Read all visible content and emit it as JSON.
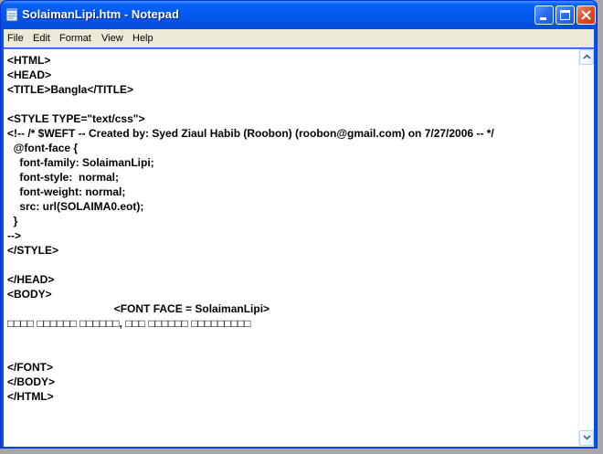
{
  "window": {
    "title": "SolaimanLipi.htm - Notepad",
    "icon": "notepad-icon",
    "controls": {
      "minimize": "minimize-icon",
      "maximize": "maximize-icon",
      "close": "close-icon"
    }
  },
  "menu": {
    "items": [
      "File",
      "Edit",
      "Format",
      "View",
      "Help"
    ]
  },
  "editor": {
    "lines": [
      "<HTML>",
      "<HEAD>",
      "<TITLE>Bangla</TITLE>",
      "",
      "<STYLE TYPE=\"text/css\">",
      "<!-- /* $WEFT -- Created by: Syed Ziaul Habib (Roobon) (roobon@gmail.com) on 7/27/2006 -- */",
      "  @font-face {",
      "    font-family: SolaimanLipi;",
      "    font-style:  normal;",
      "    font-weight: normal;",
      "    src: url(SOLAIMA0.eot);",
      "  }",
      "-->",
      "</STYLE>",
      "",
      "</HEAD>",
      "<BODY>",
      "                                   <FONT FACE = SolaimanLipi>",
      "□□□□ □□□□□□ □□□□□□, □□□ □□□□□□ □□□□□□□□□",
      "",
      "",
      "</FONT>",
      "</BODY>",
      "</HTML>"
    ]
  },
  "scrollbar": {
    "up": "scroll-up-arrow-icon",
    "down": "scroll-down-arrow-icon"
  }
}
